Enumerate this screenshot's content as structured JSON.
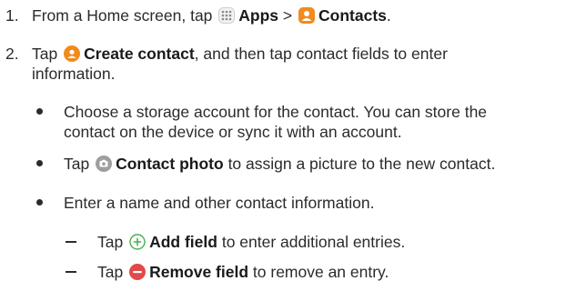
{
  "steps": [
    {
      "num": "1.",
      "pre": "From a Home screen, tap",
      "apps_label": "Apps",
      "sep": ">",
      "contacts_label": "Contacts",
      "end": "."
    },
    {
      "num": "2.",
      "pre": "Tap",
      "create_label": "Create contact",
      "line1_rest": ", and then tap contact fields to enter",
      "line2": "information."
    }
  ],
  "bullets": [
    {
      "line1": "Choose a storage account for the contact. You can store the",
      "line2": "contact on the device or sync it with an account."
    },
    {
      "pre": "Tap",
      "label": "Contact photo",
      "rest": "to assign a picture to the new contact."
    },
    {
      "text": "Enter a name and other contact information."
    }
  ],
  "subitems": [
    {
      "pre": "Tap",
      "label": "Add field",
      "rest": "to enter additional entries."
    },
    {
      "pre": "Tap",
      "label": "Remove field",
      "rest": "to remove an entry."
    }
  ],
  "colors": {
    "contacts_orange": "#f28a1c",
    "camera_gray": "#9e9e9e",
    "add_green": "#4caf50",
    "remove_red": "#e04a4a"
  }
}
